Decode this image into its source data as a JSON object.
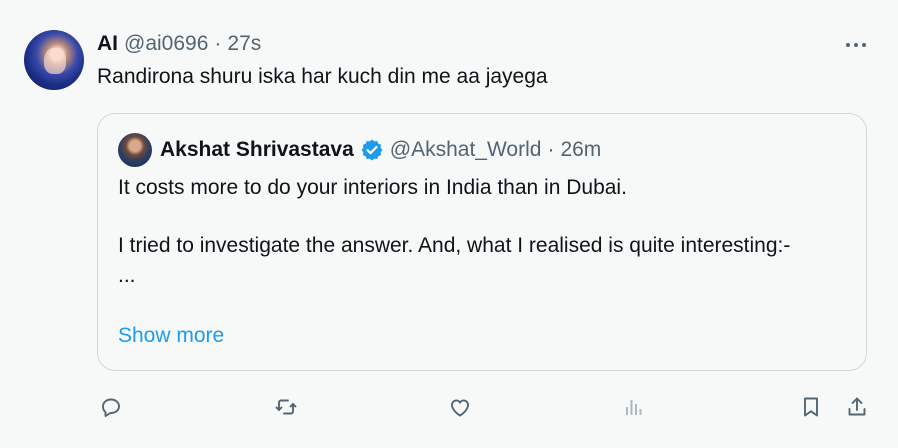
{
  "tweet": {
    "author_name": "AI",
    "handle": "@ai0696",
    "separator": "·",
    "time": "27s",
    "text": "Randirona shuru iska har kuch din me aa jayega"
  },
  "quote": {
    "author_name": "Akshat Shrivastava",
    "handle": "@Akshat_World",
    "separator": "·",
    "time": "26m",
    "paragraphs": [
      "It costs more to do your interiors in India than in Dubai.",
      "I tried to investigate the answer. And, what I realised is quite interesting:-",
      "..."
    ],
    "show_more_label": "Show more"
  },
  "colors": {
    "background": "#f7f9f9",
    "text_primary": "#0f1419",
    "text_secondary": "#536471",
    "link_blue": "#1d9bf0",
    "border": "#cfd9de"
  },
  "actions": [
    "reply-icon",
    "retweet-icon",
    "like-icon",
    "views-icon",
    "bookmark-icon",
    "share-icon"
  ]
}
